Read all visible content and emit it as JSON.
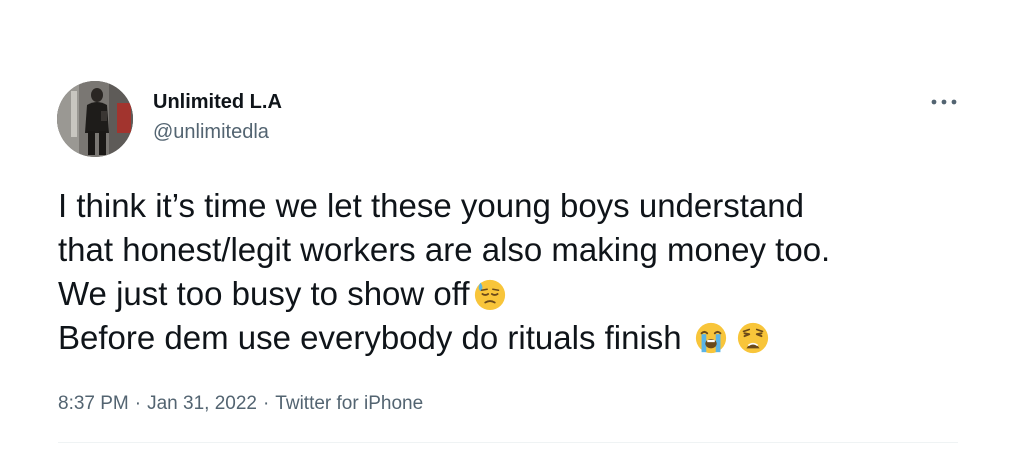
{
  "author": {
    "name": "Unlimited L.A",
    "handle": "@unlimitedla"
  },
  "more_icon": "more-options-icon",
  "tweet": {
    "line1": "I think it’s time we let these young boys understand",
    "line2": "that honest/legit workers are also making money too.",
    "line3": "We just too busy to show off",
    "line3_emoji": "downcast-face-with-sweat-icon",
    "line4": "Before dem use everybody do rituals finish",
    "line4_emojis": [
      "loudly-crying-face-icon",
      "weary-face-icon"
    ]
  },
  "meta": {
    "time": "8:37 PM",
    "separator": "·",
    "date": "Jan 31, 2022",
    "source": "Twitter for iPhone"
  },
  "colors": {
    "text": "#0f1419",
    "secondary": "#536471",
    "emoji_yellow": "#f8c53a",
    "emoji_blue": "#5ab4e6"
  }
}
